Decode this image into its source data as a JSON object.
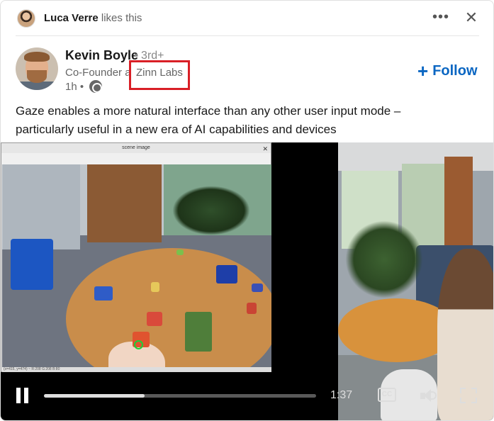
{
  "social_context": {
    "actor_name": "Luca Verre",
    "action": "likes this"
  },
  "author": {
    "name": "Kevin Boyle",
    "degree": "• 3rd+",
    "headline_prefix": "Co-Founder a",
    "company": "Zinn Labs",
    "time": "1h •"
  },
  "actions": {
    "follow_label": "Follow",
    "follow_icon": "plus-icon",
    "more_icon": "more-options-icon",
    "close_icon": "close-icon"
  },
  "post": {
    "line1": "Gaze enables a more natural interface than any other user input mode –",
    "line2": " particularly useful in a new era of AI capabilities and devices"
  },
  "video": {
    "scene_window_title": "scene image",
    "scene_status": "(x=415, y=474) ~ R:208 G:208 B:80",
    "time_remaining": "1:37",
    "cc_label": "CC",
    "progress": 0.37
  },
  "colors": {
    "brand_blue": "#0a66c2",
    "highlight_red": "#d91f26"
  }
}
